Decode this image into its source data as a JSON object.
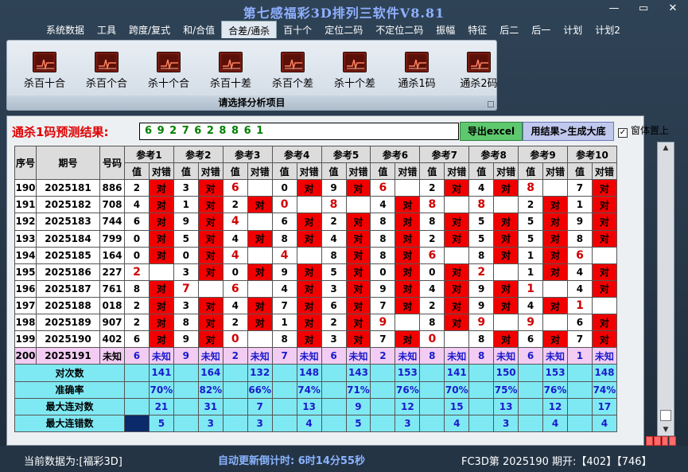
{
  "window": {
    "title": "第七感福彩3D排列三软件V8.81",
    "min": "—",
    "max": "▭",
    "close": "✕"
  },
  "menu": [
    "系统数据",
    "工具",
    "跨度/复式",
    "和/合值",
    "合差/通杀",
    "百十个",
    "定位二码",
    "不定位二码",
    "振幅",
    "特征",
    "后二",
    "后一",
    "计划",
    "计划2"
  ],
  "menu_active": 4,
  "ribbon": {
    "caption": "请选择分析项目",
    "tools": [
      "杀百十合",
      "杀百个合",
      "杀十个合",
      "杀百十差",
      "杀百个差",
      "杀十个差",
      "通杀1码",
      "通杀2码"
    ]
  },
  "prediction": {
    "label": "通杀1码预测结果:",
    "value": "6 9 2 7 6 2 8 8 6 1",
    "export_btn": "导出excel",
    "gen_btn": "用结果>生成大底",
    "pin_label": "窗体置上",
    "pin_checked": "✓"
  },
  "table": {
    "headers": {
      "seq": "序号",
      "period": "期号",
      "number": "号码",
      "val": "值",
      "hit": "对错"
    },
    "refs": [
      "参考1",
      "参考2",
      "参考3",
      "参考4",
      "参考5",
      "参考6",
      "参考7",
      "参考8",
      "参考9",
      "参考10"
    ],
    "rows": [
      {
        "seq": "190",
        "period": "2025181",
        "num": "886",
        "vals": [
          "2",
          "3",
          "6",
          "0",
          "9",
          "6",
          "2",
          "4",
          "8",
          "7"
        ],
        "hits": [
          1,
          1,
          0,
          1,
          1,
          0,
          1,
          1,
          0,
          1
        ],
        "reds": [
          0,
          0,
          1,
          0,
          0,
          1,
          0,
          0,
          1,
          0
        ]
      },
      {
        "seq": "191",
        "period": "2025182",
        "num": "708",
        "vals": [
          "4",
          "1",
          "2",
          "0",
          "8",
          "4",
          "8",
          "8",
          "2",
          "1"
        ],
        "hits": [
          1,
          1,
          1,
          0,
          0,
          1,
          0,
          0,
          1,
          1
        ],
        "reds": [
          0,
          0,
          0,
          1,
          1,
          0,
          1,
          1,
          0,
          0
        ]
      },
      {
        "seq": "192",
        "period": "2025183",
        "num": "744",
        "vals": [
          "6",
          "9",
          "4",
          "6",
          "2",
          "8",
          "8",
          "5",
          "5",
          "9"
        ],
        "hits": [
          1,
          1,
          0,
          1,
          1,
          1,
          1,
          1,
          1,
          1
        ],
        "reds": [
          0,
          0,
          1,
          0,
          0,
          0,
          0,
          0,
          0,
          0
        ]
      },
      {
        "seq": "193",
        "period": "2025184",
        "num": "799",
        "vals": [
          "0",
          "5",
          "4",
          "8",
          "4",
          "8",
          "2",
          "5",
          "5",
          "8"
        ],
        "hits": [
          1,
          1,
          1,
          1,
          1,
          1,
          1,
          1,
          1,
          1
        ],
        "reds": [
          0,
          0,
          0,
          0,
          0,
          0,
          0,
          0,
          0,
          0
        ]
      },
      {
        "seq": "194",
        "period": "2025185",
        "num": "164",
        "vals": [
          "0",
          "0",
          "4",
          "4",
          "8",
          "8",
          "6",
          "8",
          "1",
          "6"
        ],
        "hits": [
          1,
          1,
          0,
          0,
          1,
          1,
          0,
          1,
          1,
          0
        ],
        "reds": [
          0,
          0,
          1,
          1,
          0,
          0,
          1,
          0,
          0,
          1
        ]
      },
      {
        "seq": "195",
        "period": "2025186",
        "num": "227",
        "vals": [
          "2",
          "3",
          "0",
          "9",
          "5",
          "0",
          "0",
          "2",
          "1",
          "4"
        ],
        "hits": [
          0,
          1,
          1,
          1,
          1,
          1,
          1,
          0,
          1,
          1
        ],
        "reds": [
          1,
          0,
          0,
          0,
          0,
          0,
          0,
          1,
          0,
          0
        ]
      },
      {
        "seq": "196",
        "period": "2025187",
        "num": "761",
        "vals": [
          "8",
          "7",
          "6",
          "4",
          "3",
          "9",
          "4",
          "9",
          "1",
          "4"
        ],
        "hits": [
          1,
          0,
          0,
          1,
          1,
          1,
          1,
          1,
          0,
          1
        ],
        "reds": [
          0,
          1,
          1,
          0,
          0,
          0,
          0,
          0,
          1,
          0
        ]
      },
      {
        "seq": "197",
        "period": "2025188",
        "num": "018",
        "vals": [
          "2",
          "3",
          "4",
          "7",
          "6",
          "7",
          "2",
          "9",
          "4",
          "1"
        ],
        "hits": [
          1,
          1,
          1,
          1,
          1,
          1,
          1,
          1,
          1,
          0
        ],
        "reds": [
          0,
          0,
          0,
          0,
          0,
          0,
          0,
          0,
          0,
          1
        ]
      },
      {
        "seq": "198",
        "period": "2025189",
        "num": "907",
        "vals": [
          "2",
          "8",
          "2",
          "1",
          "2",
          "9",
          "8",
          "9",
          "9",
          "6"
        ],
        "hits": [
          1,
          1,
          1,
          1,
          1,
          0,
          1,
          0,
          0,
          1
        ],
        "reds": [
          0,
          0,
          0,
          0,
          0,
          1,
          0,
          1,
          1,
          0
        ]
      },
      {
        "seq": "199",
        "period": "2025190",
        "num": "402",
        "vals": [
          "6",
          "9",
          "0",
          "8",
          "3",
          "7",
          "0",
          "8",
          "6",
          "7"
        ],
        "hits": [
          1,
          1,
          0,
          1,
          1,
          1,
          0,
          1,
          1,
          1
        ],
        "reds": [
          0,
          0,
          1,
          0,
          0,
          0,
          1,
          0,
          0,
          0
        ]
      }
    ],
    "pred_row": {
      "seq": "200",
      "period": "2025191",
      "num": "未知",
      "vals": [
        "6",
        "9",
        "2",
        "7",
        "6",
        "2",
        "8",
        "8",
        "6",
        "1"
      ],
      "hit": "未知"
    },
    "ok_text": "对",
    "stats": [
      {
        "label": "对次数",
        "vals": [
          "141",
          "164",
          "132",
          "148",
          "143",
          "153",
          "141",
          "150",
          "153",
          "148"
        ]
      },
      {
        "label": "准确率",
        "vals": [
          "70%",
          "82%",
          "66%",
          "74%",
          "71%",
          "76%",
          "70%",
          "75%",
          "76%",
          "74%"
        ]
      },
      {
        "label": "最大连对数",
        "vals": [
          "21",
          "31",
          "7",
          "13",
          "9",
          "12",
          "15",
          "13",
          "12",
          "17"
        ]
      },
      {
        "label": "最大连错数",
        "vals": [
          "5",
          "3",
          "3",
          "4",
          "5",
          "3",
          "4",
          "3",
          "4",
          "4"
        ]
      }
    ]
  },
  "status": {
    "data_src": "当前数据为:[福彩3D]",
    "countdown": "自动更新倒计时:  6时14分55秒",
    "latest": "FC3D第 2025190 期开:【402】【746】"
  },
  "colors": {
    "hit": "#f20000",
    "pred_row": "#f3ccf3",
    "stat_row": "#7fe9f3",
    "title": "#8fb0ff"
  }
}
